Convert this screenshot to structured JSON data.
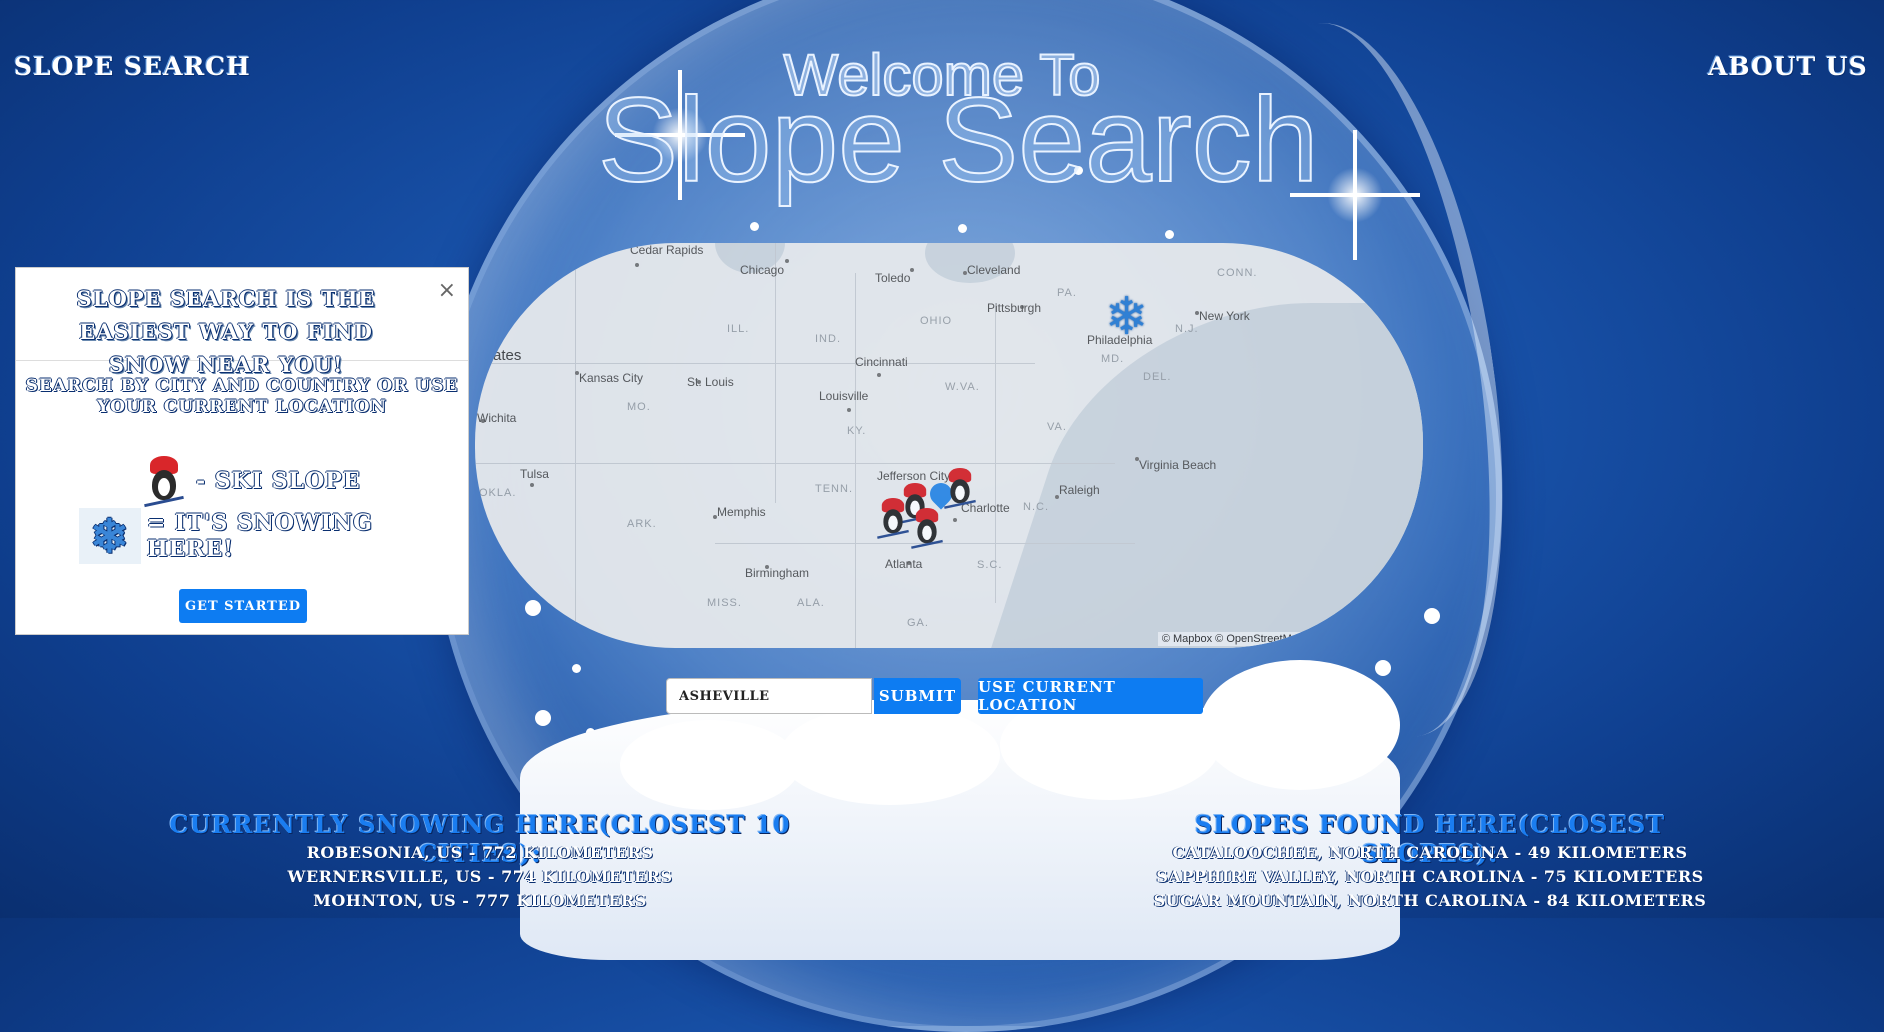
{
  "nav": {
    "brand": "Slope Search",
    "about": "About Us"
  },
  "hero": {
    "welcome": "Welcome To",
    "title": "Slope Search"
  },
  "modal": {
    "title": "Slope Search is the easiest way to find snow near you!",
    "close": "×",
    "subtitle": "Search by city and country or use your current location",
    "legend_slope": "- Ski Slope",
    "legend_snow": "= It's snowing here!",
    "get_started": "Get Started"
  },
  "map": {
    "attribution": "© Mapbox © OpenStreetMap",
    "cities": [
      "Cedar Rapids",
      "Chicago",
      "Toledo",
      "Cleveland",
      "Pittsburgh",
      "New York",
      "Philadelphia",
      "Kansas City",
      "St. Louis",
      "Cincinnati",
      "Louisville",
      "Wichita",
      "Tulsa",
      "Memphis",
      "Jefferson City",
      "Charlotte",
      "Raleigh",
      "Virginia Beach",
      "Birmingham",
      "Atlanta"
    ],
    "states": [
      "PA.",
      "CONN.",
      "N.J.",
      "OHIO",
      "IND.",
      "ILL.",
      "MO.",
      "KY.",
      "W.VA.",
      "VA.",
      "TENN.",
      "N.C.",
      "S.C.",
      "ARK.",
      "MISS.",
      "ALA.",
      "GA.",
      "OKLA.",
      "MD.",
      "DEL."
    ],
    "partial_label": "ates"
  },
  "search": {
    "value": "ASHEVILLE",
    "submit": "Submit",
    "use_location": "Use Current Location"
  },
  "snowing": {
    "title": "Currently snowing here(closest 10 cities):",
    "items": [
      "Robesonia, US - 772 kilometers",
      "Wernersville, US - 774 kilometers",
      "Mohnton, US - 777 kilometers"
    ]
  },
  "slopes": {
    "title": "Slopes Found Here(closest slopes):",
    "items": [
      "Cataloochee, North Carolina - 49 kilometers",
      "Sapphire Valley, North Carolina - 75 kilometers",
      "Sugar Mountain, North Carolina - 84 kilometers"
    ]
  },
  "colors": {
    "accent": "#0d7cf2",
    "background": "#1a55ad"
  }
}
